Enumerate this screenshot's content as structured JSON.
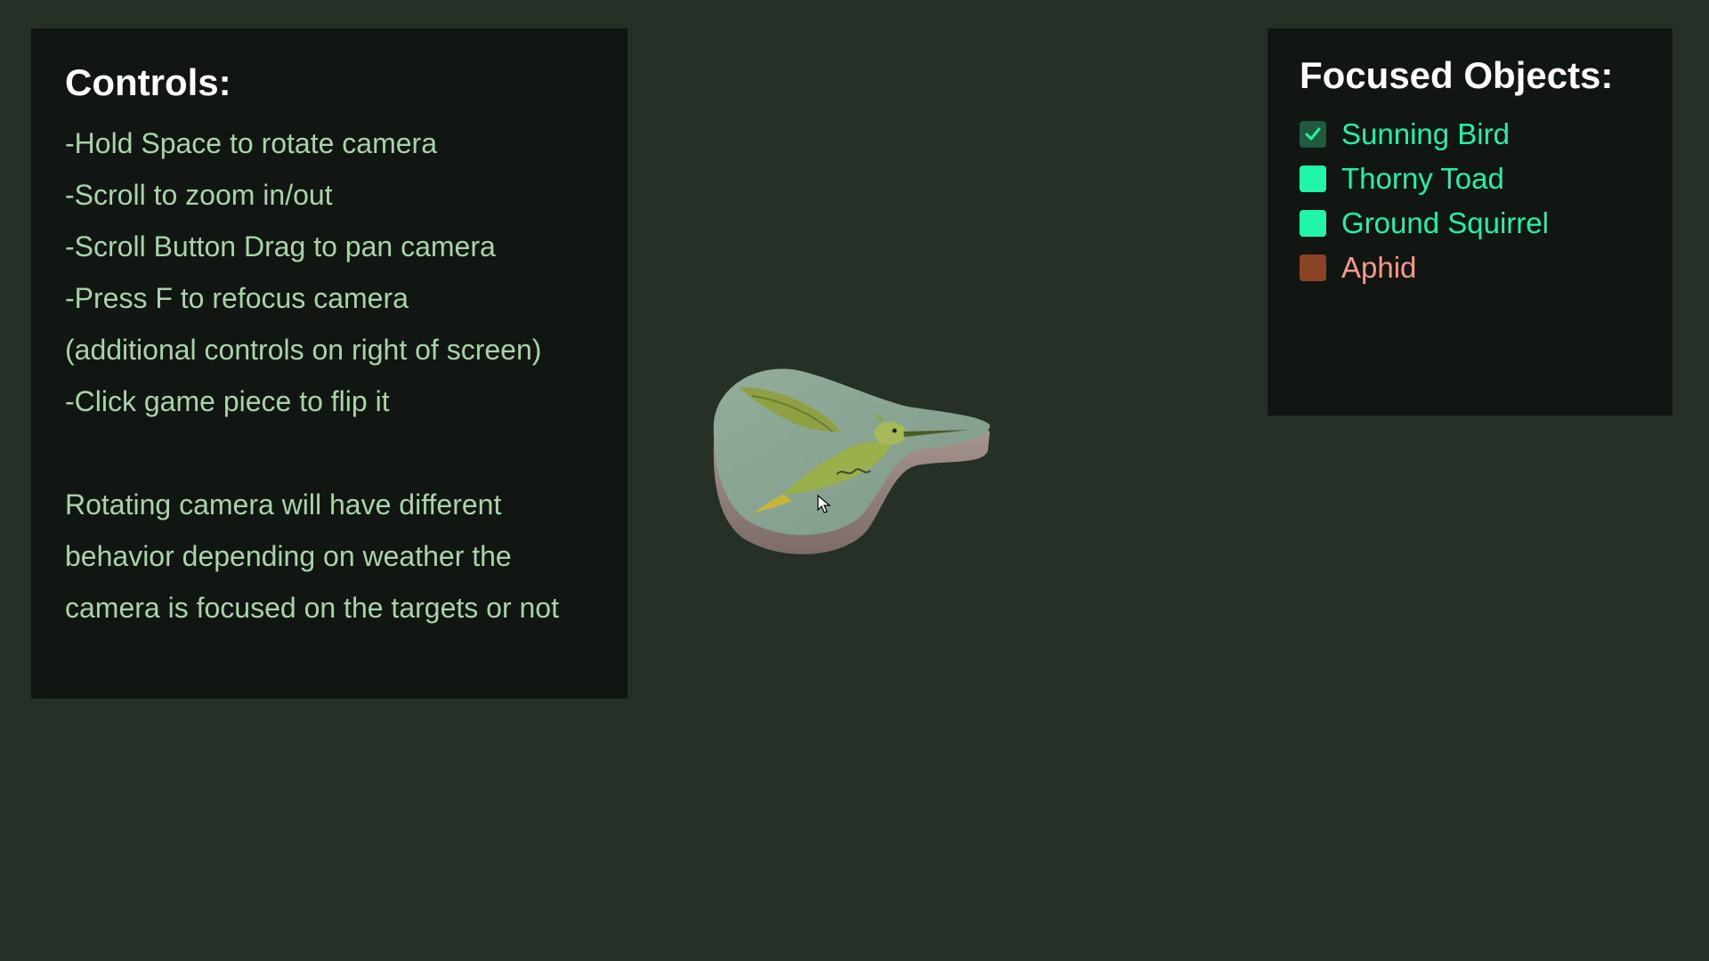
{
  "controls": {
    "title": "Controls:",
    "lines": [
      "-Hold Space to rotate camera",
      "-Scroll to zoom in/out",
      "-Scroll Button Drag to pan camera",
      "-Press F to refocus camera",
      "(additional controls on right of screen)",
      "-Click game piece to flip it"
    ],
    "note": [
      "Rotating camera will have different",
      "behavior depending on weather the",
      "camera is focused on the targets or not"
    ]
  },
  "focused_objects": {
    "title": "Focused Objects:",
    "items": [
      {
        "label": "Sunning Bird",
        "checked": true,
        "box_color": "#1f5a3f",
        "text_color": "#22f2a6",
        "icon": "check-icon"
      },
      {
        "label": "Thorny Toad",
        "checked": false,
        "box_color": "#20f5a8",
        "text_color": "#22f2a6"
      },
      {
        "label": "Ground Squirrel",
        "checked": false,
        "box_color": "#20f5a8",
        "text_color": "#22f2a6"
      },
      {
        "label": "Aphid",
        "checked": false,
        "box_color": "#8a4325",
        "text_color": "#f59a8a"
      }
    ]
  },
  "colors": {
    "background": "#263026",
    "panel": "#121612",
    "controls_text": "#a9d3a9",
    "title_text": "#ffffff"
  },
  "game_piece": {
    "subject": "hummingbird",
    "icon": "game-piece-token"
  }
}
